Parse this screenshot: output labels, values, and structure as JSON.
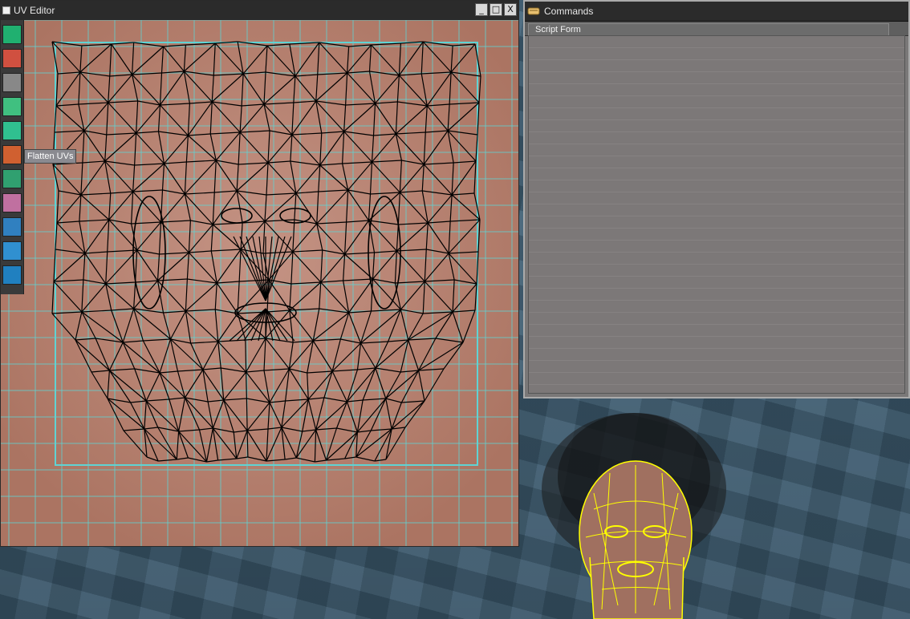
{
  "uv_editor": {
    "title": "UV Editor",
    "buttons": {
      "minimize": "_",
      "maximize": "□",
      "close": "X"
    },
    "tooltip": "Flatten UVs",
    "tools": [
      {
        "name": "select-faces-tool-icon"
      },
      {
        "name": "select-vertices-tool-icon"
      },
      {
        "name": "sphere-map-tool-icon"
      },
      {
        "name": "brush-tool-icon"
      },
      {
        "name": "planar-map-tool-icon"
      },
      {
        "name": "flatten-uvs-tool-icon"
      },
      {
        "name": "relax-tool-icon"
      },
      {
        "name": "texture-tool-icon"
      },
      {
        "name": "unwrap-tool-icon"
      },
      {
        "name": "arrow-tool-icon"
      },
      {
        "name": "rotate-tool-icon"
      }
    ]
  },
  "commands": {
    "title": "Commands",
    "tab": "Script Form"
  },
  "colors": {
    "uv_grid": "#5fd3d3",
    "mesh_lines": "#000000",
    "skin_texture": "#b37d6a",
    "viewport_wireframe": "#ffff00"
  }
}
